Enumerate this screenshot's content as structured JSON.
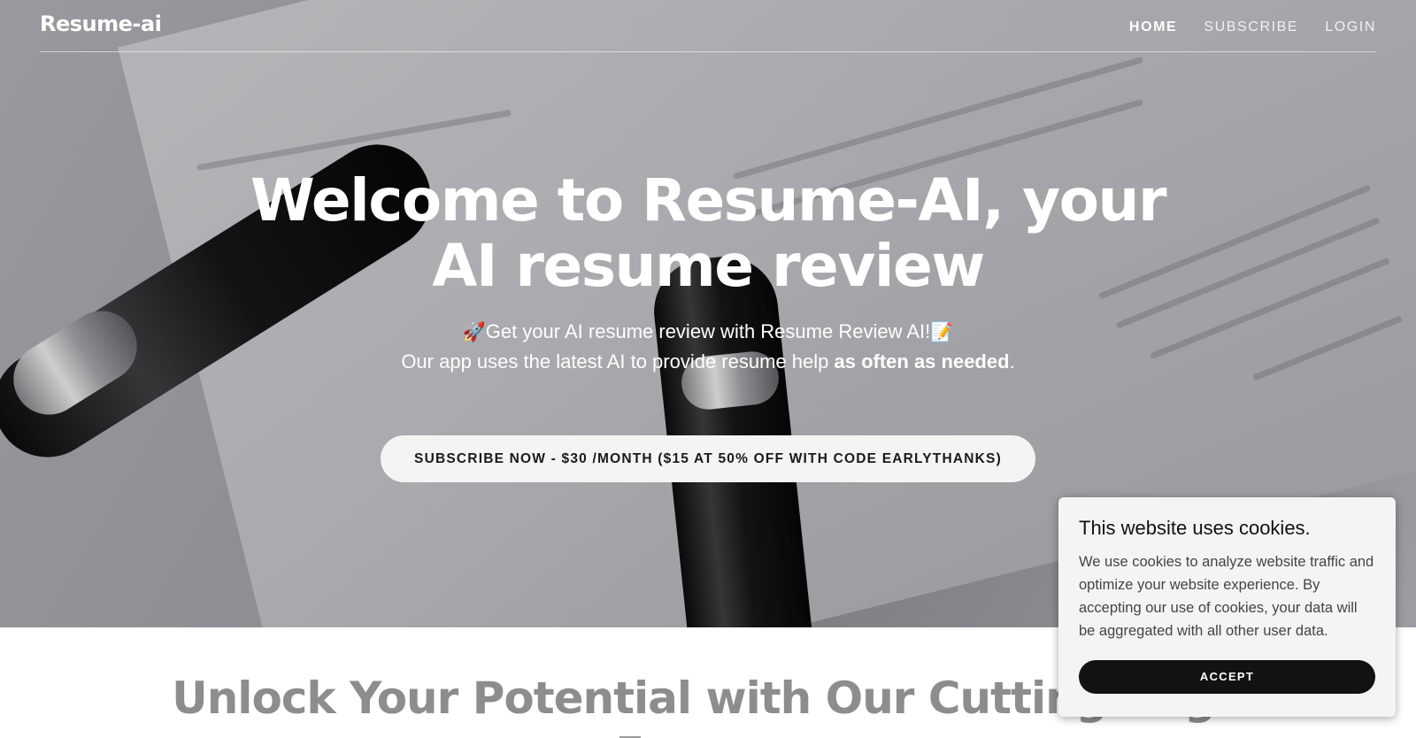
{
  "nav": {
    "brand": "Resume-ai",
    "links": [
      "HOME",
      "SUBSCRIBE",
      "LOGIN"
    ]
  },
  "hero": {
    "title": "Welcome to Resume-AI, your AI resume review",
    "subtitle_line1_emoji_start": "🚀",
    "subtitle_line1": "Get your AI resume review with Resume Review AI!",
    "subtitle_line1_emoji_end": "📝",
    "subtitle_line2_prefix": "Our app uses the latest AI to provide resume help ",
    "subtitle_line2_bold": "as often as needed",
    "subtitle_line2_suffix": ".",
    "cta_label": "SUBSCRIBE NOW - $30 /MONTH ($15 AT 50% OFF WITH CODE EARLYTHANKS)"
  },
  "section": {
    "title": "Unlock Your Potential with Our Cutting-Edge"
  },
  "cookie_banner": {
    "title": "This website uses cookies.",
    "text": "We use cookies to analyze website traffic and optimize your website experience. By accepting our use of cookies, your data will be aggregated with all other user data.",
    "accept_label": "ACCEPT"
  },
  "colors": {
    "nav_text": "#ffffff",
    "cta_bg": "#f4f4f2",
    "cookie_button_bg": "#121212",
    "section_title": "#8d8d8d"
  }
}
